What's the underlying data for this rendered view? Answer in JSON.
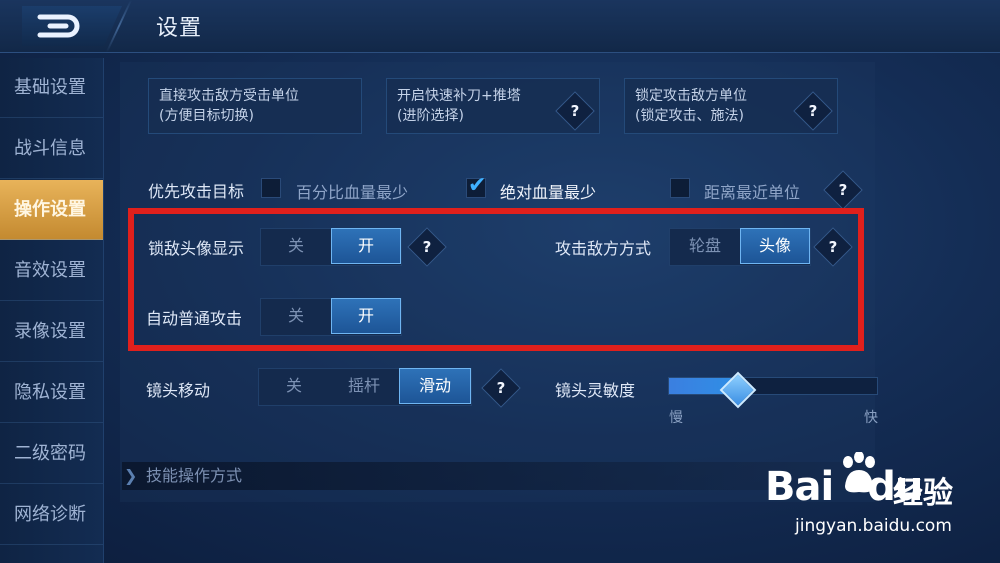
{
  "header": {
    "title": "设置",
    "back_icon": "back-arrow-icon"
  },
  "sidebar": {
    "items": [
      {
        "label": "基础设置",
        "active": false
      },
      {
        "label": "战斗信息",
        "active": false
      },
      {
        "label": "操作设置",
        "active": true
      },
      {
        "label": "音效设置",
        "active": false
      },
      {
        "label": "录像设置",
        "active": false
      },
      {
        "label": "隐私设置",
        "active": false
      },
      {
        "label": "二级密码",
        "active": false
      },
      {
        "label": "网络诊断",
        "active": false
      }
    ]
  },
  "attack_modes": [
    {
      "line1": "直接攻击敌方受击单位",
      "line2": "(方便目标切换)"
    },
    {
      "line1": "开启快速补刀+推塔",
      "line2": "(进阶选择)"
    },
    {
      "line1": "锁定攻击敌方单位",
      "line2": "(锁定攻击、施法)"
    }
  ],
  "priority": {
    "label": "优先攻击目标",
    "options": [
      {
        "label": "百分比血量最少",
        "checked": false
      },
      {
        "label": "绝对血量最少",
        "checked": true
      },
      {
        "label": "距离最近单位",
        "checked": false
      }
    ]
  },
  "lock_avatar": {
    "label": "锁敌头像显示",
    "off": "关",
    "on": "开",
    "value": "开"
  },
  "attack_method": {
    "label": "攻击敌方方式",
    "opt1": "轮盘",
    "opt2": "头像",
    "value": "头像"
  },
  "auto_attack": {
    "label": "自动普通攻击",
    "off": "关",
    "on": "开",
    "value": "开"
  },
  "camera_move": {
    "label": "镜头移动",
    "opt1": "关",
    "opt2": "摇杆",
    "opt3": "滑动",
    "value": "滑动"
  },
  "camera_sensitivity": {
    "label": "镜头灵敏度",
    "slow": "慢",
    "fast": "快",
    "level": 0.33
  },
  "skill_section": {
    "label": "技能操作方式"
  },
  "help_glyph": "?",
  "watermark": {
    "brand": "Bai",
    "brand2": "du",
    "jingyan": "经验",
    "url": "jingyan.baidu.com"
  },
  "colors": {
    "accent_gold": "#d9a245",
    "toggle_on": "#2a6cb3",
    "highlight_red": "#e0201c"
  }
}
